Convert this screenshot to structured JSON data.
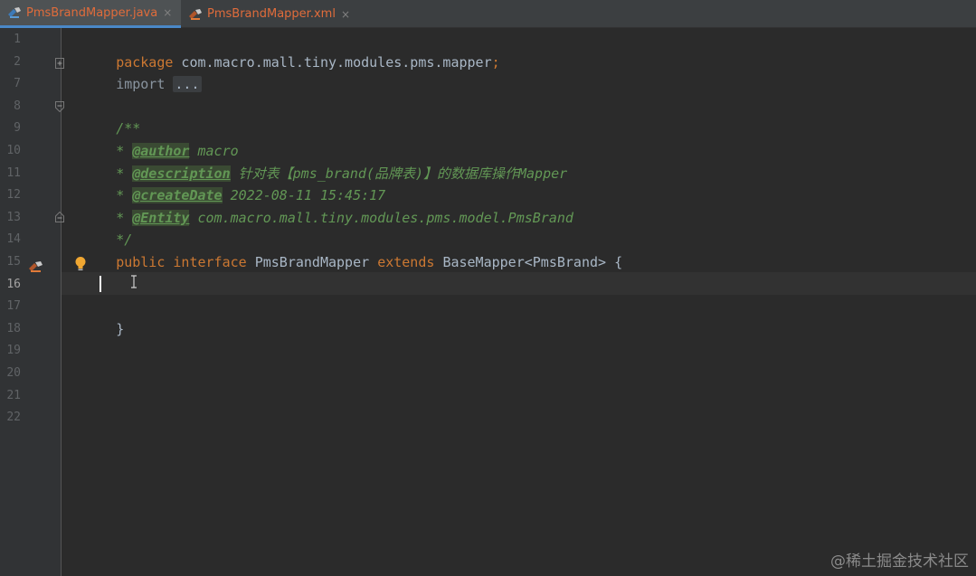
{
  "tabs": [
    {
      "label": "PmsBrandMapper.java",
      "icon": "mapper-java-icon",
      "active": true
    },
    {
      "label": "PmsBrandMapper.xml",
      "icon": "mapper-xml-icon",
      "active": false
    }
  ],
  "tab_close_glyph": "×",
  "line_numbers": [
    "1",
    "2",
    "7",
    "8",
    "9",
    "10",
    "11",
    "12",
    "13",
    "14",
    "15",
    "16",
    "17",
    "18",
    "19",
    "20",
    "21",
    "22"
  ],
  "code": {
    "l1_kw": "package",
    "l1_rest": " com.macro.mall.tiny.modules.pms.mapper",
    "l1_semi": ";",
    "l2_kw": "import",
    "l2_dots": "...",
    "l8": "/**",
    "l9_star": "* ",
    "l9_tag": "@author",
    "l9_val": " macro",
    "l10_star": "* ",
    "l10_tag": "@description",
    "l10_val": " 针对表【pms_brand(品牌表)】的数据库操作Mapper",
    "l11_star": "* ",
    "l11_tag": "@createDate",
    "l11_val": " 2022-08-11 15:45:17",
    "l12_star": "* ",
    "l12_tag": "@Entity",
    "l12_val": " com.macro.mall.tiny.modules.pms.model.PmsBrand",
    "l13": "*/",
    "l14_kw1": "public",
    "l14_kw2": "interface",
    "l14_name": "PmsBrandMapper",
    "l14_kw3": "extends",
    "l14_rest": "BaseMapper<PmsBrand> {",
    "l17": "}"
  },
  "current_line": "16",
  "watermark": "@稀土掘金技术社区",
  "colors": {
    "editor_bg": "#2b2b2b",
    "keyword": "#cc7832",
    "doc_comment": "#629755",
    "text": "#a9b7c6",
    "tab_label": "#e06c3b"
  }
}
